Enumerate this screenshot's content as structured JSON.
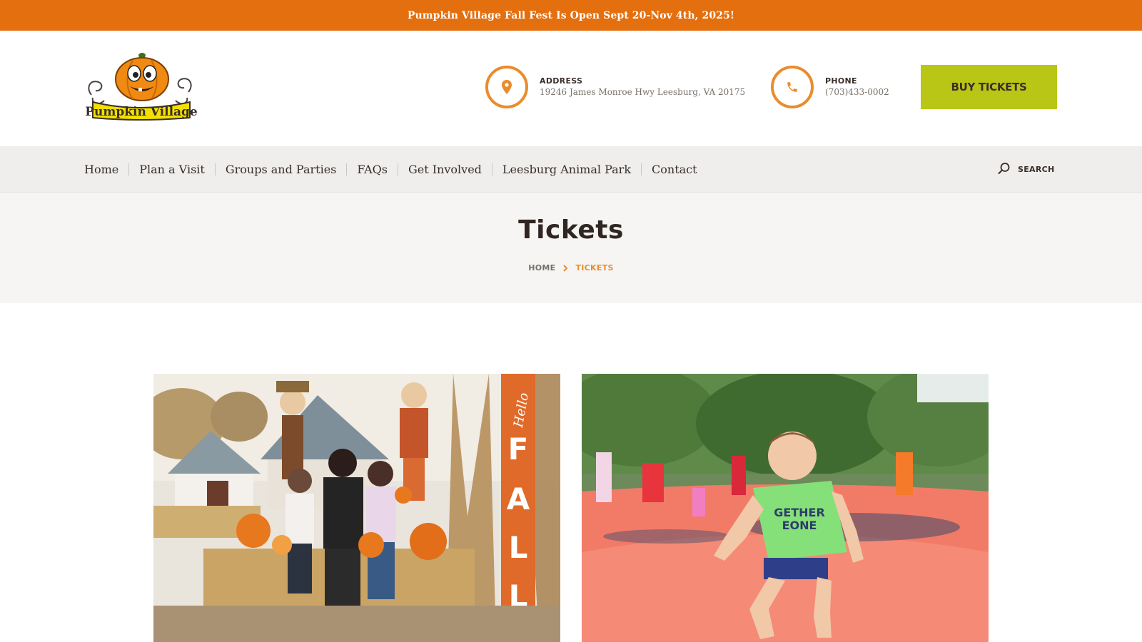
{
  "announcement": {
    "text": "Pumpkin Village Fall Fest Is Open Sept 20-Nov 4th, 2025!"
  },
  "header": {
    "logo_text": "Pumpkin Village",
    "address": {
      "label": "ADDRESS",
      "value": "19246 James Monroe Hwy Leesburg, VA 20175"
    },
    "phone": {
      "label": "PHONE",
      "value": "(703)433-0002"
    },
    "buy_tickets_label": "BUY TICKETS"
  },
  "nav": {
    "items": [
      "Home",
      "Plan a Visit",
      "Groups and Parties",
      "FAQs",
      "Get Involved",
      "Leesburg Animal Park",
      "Contact"
    ],
    "search_label": "SEARCH"
  },
  "page": {
    "title": "Tickets",
    "breadcrumb": {
      "home": "HOME",
      "current": "TICKETS"
    }
  },
  "photos": {
    "left": {
      "sign_text": "FALL",
      "sign_script": "Hello"
    }
  },
  "colors": {
    "announcement_bg": "#e46f0f",
    "accent_orange": "#ea8c2c",
    "buy_button_bg": "#b9c615",
    "nav_bg": "#efeeed",
    "hero_bg": "#f6f5f4",
    "text_dark": "#3a2f2a"
  },
  "icons": {
    "address": "map-pin-icon",
    "phone": "phone-icon",
    "search": "search-icon",
    "breadcrumb_separator": "chevron-right-icon"
  }
}
